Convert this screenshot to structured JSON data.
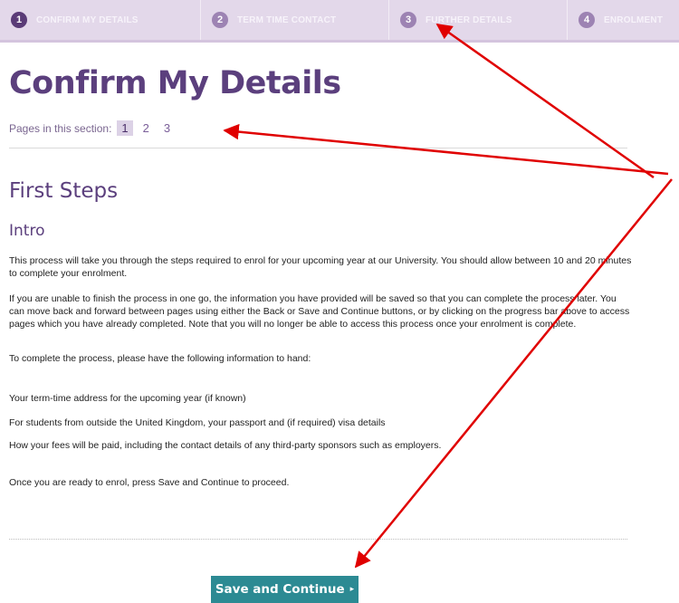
{
  "progress": {
    "steps": [
      {
        "number": "1",
        "label": "CONFIRM MY DETAILS"
      },
      {
        "number": "2",
        "label": "TERM TIME CONTACT"
      },
      {
        "number": "3",
        "label": "FURTHER DETAILS"
      },
      {
        "number": "4",
        "label": "ENROLMENT"
      }
    ]
  },
  "page": {
    "title": "Confirm My Details",
    "pages_label": "Pages in this section:",
    "pages": [
      "1",
      "2",
      "3"
    ],
    "current_page": "1"
  },
  "section": {
    "title": "First Steps",
    "subtitle": "Intro",
    "paragraphs": [
      "This process will take you through the steps required to enrol for your upcoming year at our University. You should allow between 10 and 20 minutes to complete your enrolment.",
      "If you are unable to finish the process in one go, the information you have provided will be saved so that you can complete the process later. You can move back and forward between pages using either the Back or Save and Continue buttons, or by clicking on the progress bar above to access pages which you have already completed. Note that you will no longer be able to access this process once your enrolment is complete.",
      "To complete the process, please have the following information to hand:",
      "Your term-time address for the upcoming year (if known)",
      "For students from outside the United Kingdom, your passport and (if required) visa details",
      "How your fees will be paid, including the contact details of any third-party sponsors such as employers.",
      "Once you are ready to enrol, press Save and Continue to proceed."
    ]
  },
  "actions": {
    "save_label": "Save and Continue",
    "save_arrow": "▸"
  },
  "colors": {
    "accent_purple": "#5b3f7d",
    "progress_bg": "#e3d8ea",
    "button_teal": "#2c8a93",
    "annotation_red": "#e00000"
  }
}
